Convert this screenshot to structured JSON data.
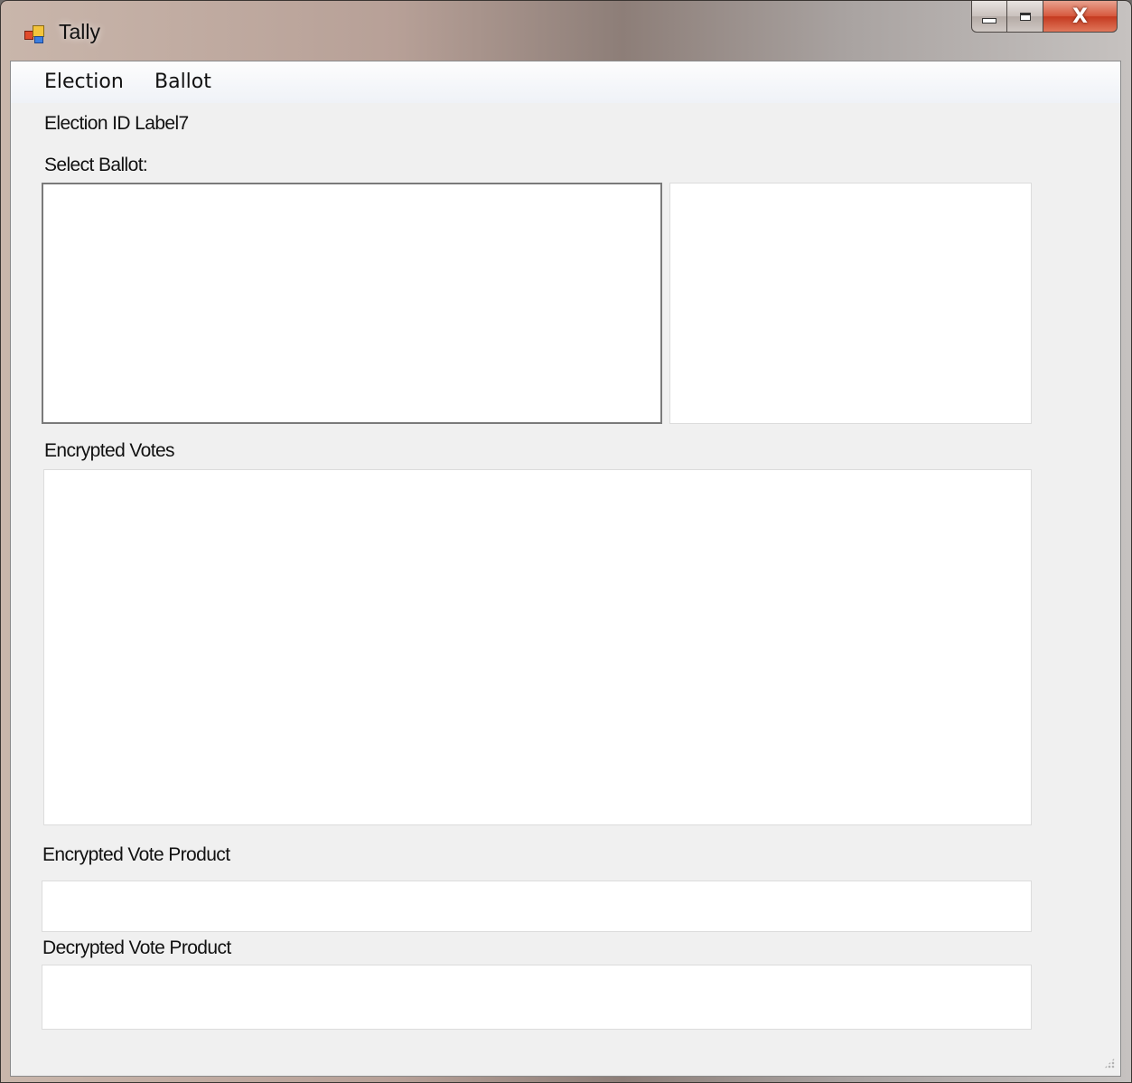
{
  "window": {
    "title": "Tally"
  },
  "menu": {
    "items": [
      "Election",
      "Ballot"
    ]
  },
  "labels": {
    "election_id": "Election ID Label7",
    "select_ballot": "Select Ballot:",
    "encrypted_votes": "Encrypted Votes",
    "encrypted_vote_product": "Encrypted Vote Product",
    "decrypted_vote_product": "Decrypted Vote Product"
  },
  "caption": {
    "close_glyph": "X"
  },
  "fields": {
    "ballot_list": "",
    "ballot_details": "",
    "encrypted_votes": "",
    "encrypted_vote_product": "",
    "decrypted_vote_product": ""
  }
}
